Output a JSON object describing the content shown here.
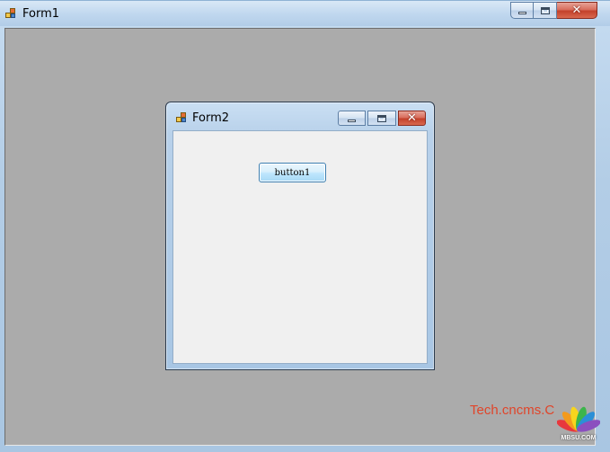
{
  "form1": {
    "title": "Form1"
  },
  "form2": {
    "title": "Form2",
    "button_label": "button1"
  },
  "watermark": {
    "text": "Tech.cncms.C",
    "logo_text": "MBSU.COM"
  },
  "colors": {
    "mdi_background": "#ababab",
    "client_background": "#f0f0f0",
    "close_button": "#c3412b",
    "watermark": "#e0452a"
  }
}
